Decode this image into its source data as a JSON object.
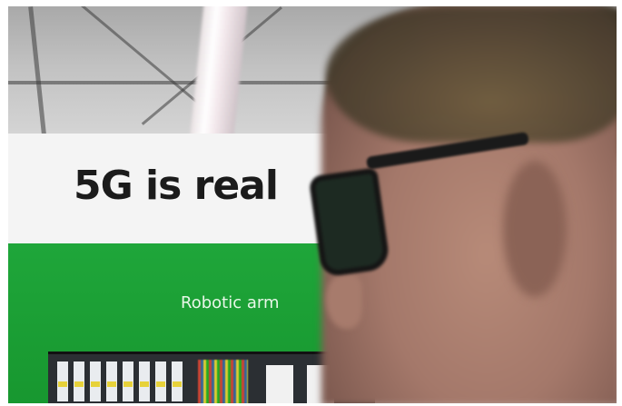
{
  "sign": {
    "headline": "5G is real",
    "subtitle": "Robotic arm"
  },
  "colors": {
    "sign_green": "#1fa63a",
    "sign_white": "#f4f4f4",
    "headline_text": "#1b1b1b"
  }
}
